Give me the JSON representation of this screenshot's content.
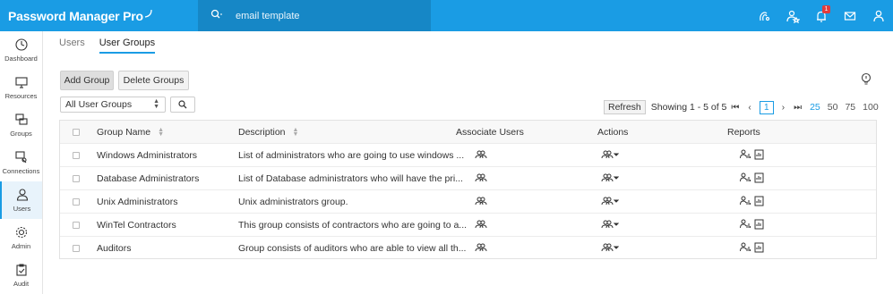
{
  "app": {
    "title": "Password Manager Pro"
  },
  "search": {
    "value": "email template"
  },
  "sidebar": {
    "items": [
      {
        "label": "Dashboard"
      },
      {
        "label": "Resources"
      },
      {
        "label": "Groups"
      },
      {
        "label": "Connections"
      },
      {
        "label": "Users"
      },
      {
        "label": "Admin"
      },
      {
        "label": "Audit"
      }
    ]
  },
  "notifications": {
    "count": "1"
  },
  "tabs": [
    {
      "label": "Users"
    },
    {
      "label": "User Groups"
    }
  ],
  "toolbar": {
    "add_label": "Add Group",
    "delete_label": "Delete Groups"
  },
  "filter": {
    "selected": "All User Groups"
  },
  "pager": {
    "refresh_label": "Refresh",
    "showing": "Showing 1 - 5 of 5",
    "current_page": "1",
    "page_sizes": [
      "25",
      "50",
      "75",
      "100"
    ]
  },
  "table": {
    "columns": [
      "Group Name",
      "Description",
      "Associate Users",
      "Actions",
      "Reports"
    ],
    "rows": [
      {
        "name": "Windows Administrators",
        "description": "List of administrators who are going to use windows ..."
      },
      {
        "name": "Database Administrators",
        "description": "List of Database administrators who will have the pri..."
      },
      {
        "name": "Unix Administrators",
        "description": "Unix administrators group."
      },
      {
        "name": "WinTel Contractors",
        "description": "This group consists of contractors who are going to a..."
      },
      {
        "name": "Auditors",
        "description": "Group consists of auditors who are able to view all th..."
      }
    ]
  },
  "colors": {
    "accent": "#1a9ce4",
    "search_bg": "#1687c6",
    "badge": "#e23b3b"
  }
}
